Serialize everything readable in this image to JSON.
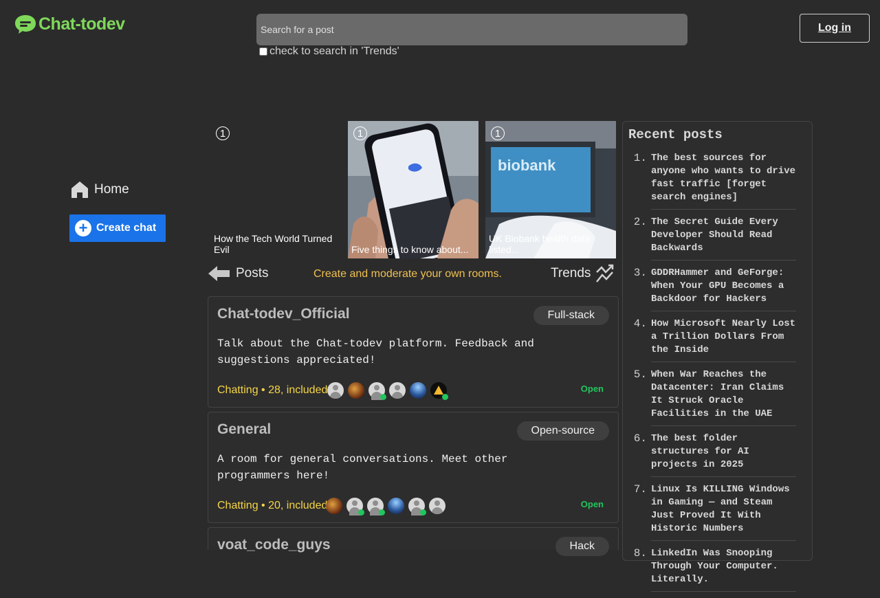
{
  "header": {
    "logo_text": "Chat-todev",
    "search_placeholder": "Search for a post",
    "trends_checkbox_label": "check to search in 'Trends'",
    "login_label": "Log in"
  },
  "nav": {
    "home_label": "Home",
    "create_chat_label": "Create chat"
  },
  "trending": [
    {
      "rank": "1",
      "caption": "How the Tech World Turned Evil"
    },
    {
      "rank": "1",
      "caption": "Five things to know about..."
    },
    {
      "rank": "1",
      "caption": "UK Biobank health data listed..."
    }
  ],
  "posts_bar": {
    "posts_label": "Posts",
    "tagline": "Create and moderate your own rooms.",
    "trends_label": "Trends"
  },
  "rooms": [
    {
      "name": "Chat-todev_Official",
      "tag": "Full-stack",
      "description": "Talk about the Chat-todev platform. Feedback and suggestions appreciated!",
      "chatting": "Chatting • 28, included",
      "status": "Open"
    },
    {
      "name": "General",
      "tag": "Open-source",
      "description": "A room for general conversations. Meet other programmers here!",
      "chatting": "Chatting • 20, included",
      "status": "Open"
    },
    {
      "name": "voat_code_guys",
      "tag": "Hack"
    }
  ],
  "recent_posts": {
    "title": "Recent posts",
    "items": [
      {
        "index": "1.",
        "title": "The best sources for anyone who wants to drive fast traffic [forget search engines]"
      },
      {
        "index": "2.",
        "title": "The Secret Guide Every Developer Should Read Backwards"
      },
      {
        "index": "3.",
        "title": "GDDRHammer and GeForge: When Your GPU Becomes a Backdoor for Hackers"
      },
      {
        "index": "4.",
        "title": "How Microsoft Nearly Lost a Trillion Dollars From the Inside"
      },
      {
        "index": "5.",
        "title": "When War Reaches the Datacenter: Iran Claims It Struck Oracle Facilities in the UAE"
      },
      {
        "index": "6.",
        "title": "The best folder structures for AI projects in 2025"
      },
      {
        "index": "7.",
        "title": "Linux Is KILLING Windows in Gaming — and Steam Just Proved It With Historic Numbers"
      },
      {
        "index": "8.",
        "title": "LinkedIn Was Snooping Through Your Computer. Literally."
      }
    ]
  },
  "colors": {
    "background": "#2b2b2b",
    "brand_green": "#7fd85a",
    "primary_blue": "#1a73e8",
    "chatting_yellow": "#f5d547",
    "open_green": "#22c55e",
    "tagline_orange": "#f0c050"
  }
}
